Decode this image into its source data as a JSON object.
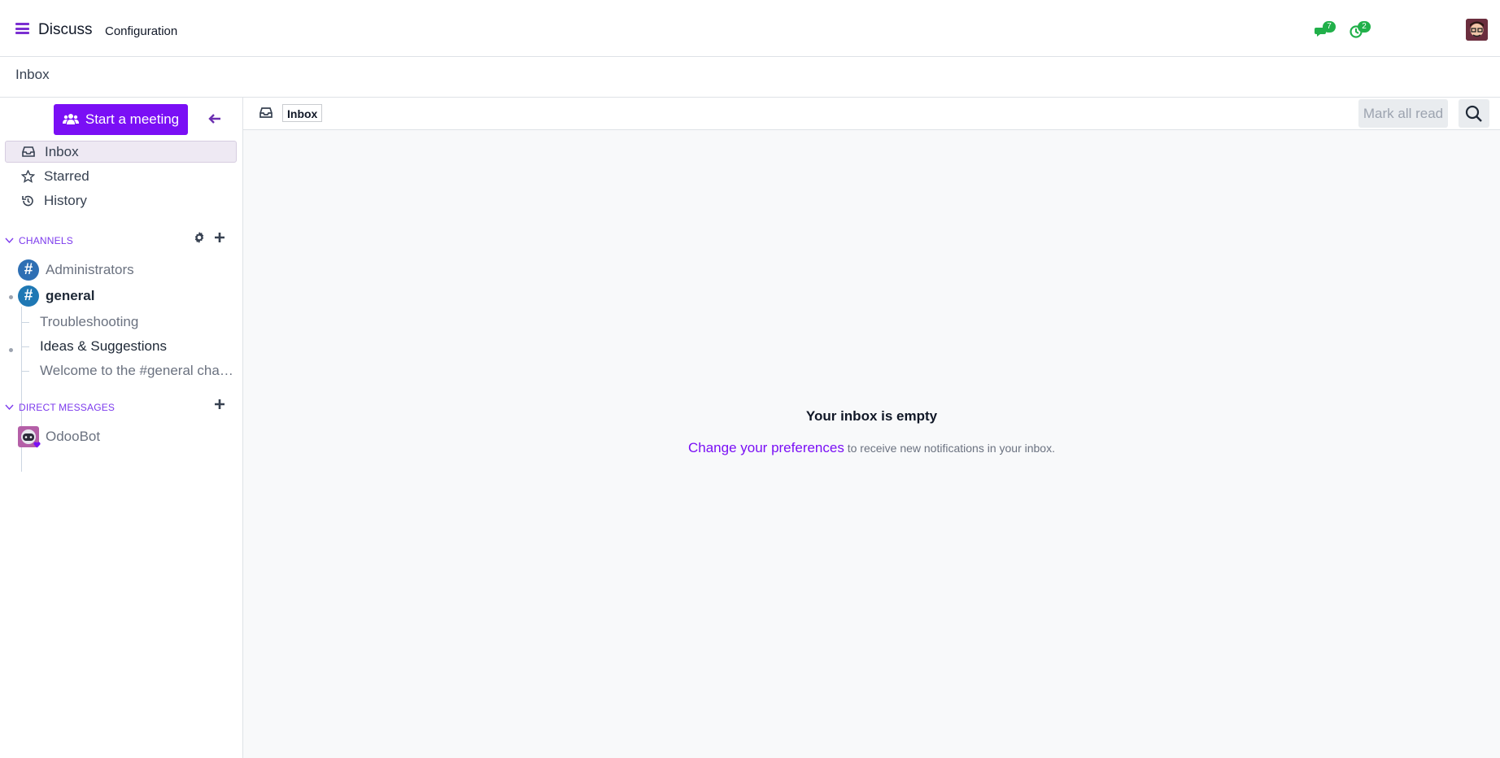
{
  "navbar": {
    "app_name": "Discuss",
    "menu_configuration": "Configuration",
    "messaging_badge": "7",
    "activity_badge": "2"
  },
  "breadcrumb": "Inbox",
  "sidebar": {
    "start_meeting_label": "Start a meeting",
    "mailboxes": [
      {
        "label": "Inbox",
        "icon": "inbox-icon",
        "active": true
      },
      {
        "label": "Starred",
        "icon": "star-icon"
      },
      {
        "label": "History",
        "icon": "history-icon"
      }
    ],
    "channels_header": "CHANNELS",
    "channels": [
      {
        "name": "Administrators",
        "color": "#2e6fb4"
      },
      {
        "name": "general",
        "color": "#1f78b4"
      }
    ],
    "threads": [
      "Troubleshooting",
      "Ideas & Suggestions",
      "Welcome to the #general cha…"
    ],
    "dm_header": "DIRECT MESSAGES",
    "direct_messages": [
      {
        "name": "OdooBot"
      }
    ]
  },
  "thread_header": {
    "title": "Inbox",
    "mark_all_read": "Mark all read"
  },
  "empty_state": {
    "title": "Your inbox is empty",
    "link": "Change your preferences",
    "suffix": " to receive new notifications in your inbox."
  },
  "colors": {
    "accent": "#7a0ff5",
    "badge": "#21b04a"
  }
}
